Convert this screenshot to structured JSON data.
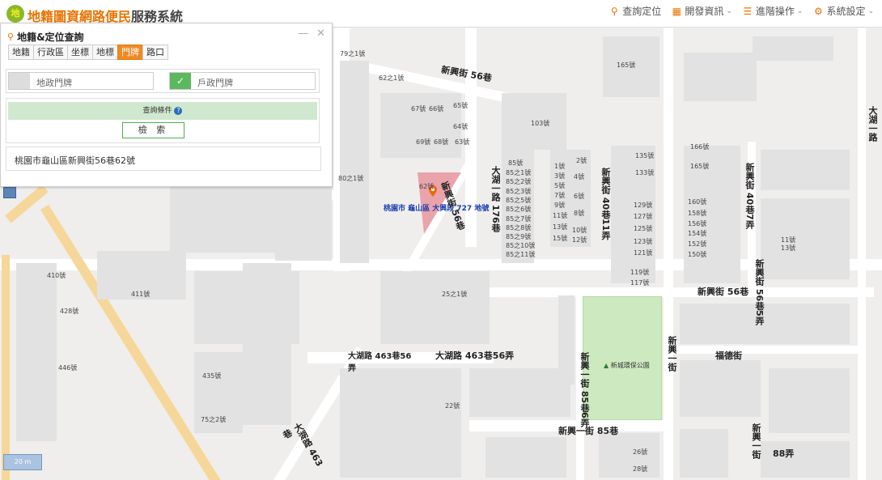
{
  "header": {
    "logo_text": "地",
    "title_orange": "地籍圖資網路便民",
    "title_dark": "服務系統",
    "nav": [
      {
        "label": "查詢定位",
        "icon": "location-pin-icon"
      },
      {
        "label": "開發資訊",
        "icon": "image-icon"
      },
      {
        "label": "進階操作",
        "icon": "list-icon"
      },
      {
        "label": "系統設定",
        "icon": "gear-icon"
      }
    ]
  },
  "panel": {
    "title": "地籍&定位查詢",
    "tabs": [
      "地籍",
      "行政區",
      "坐標",
      "地標",
      "門牌",
      "路口"
    ],
    "active_tab": "門牌",
    "fields": [
      {
        "placeholder": "地政門牌",
        "checked": false
      },
      {
        "placeholder": "戶政門牌",
        "checked": true
      }
    ],
    "condition_label": "查詢條件",
    "search_label": "檢 索",
    "result_text": "桃園市龜山區新興街56巷62號"
  },
  "map": {
    "address_label": "桃園市 龜山區 大興段 727 地號",
    "scale_label": "20 m",
    "park_label": "新城環保公園",
    "road_labels": {
      "xinxing56": "新興街 56巷",
      "xinxing56b": "新興街 56巷",
      "daxing463_56": "大湖路 463巷56弄",
      "daxing463_56b": "大湖路 463巷56弄",
      "xinxingyi85": "新興一街 85巷",
      "fude": "福德街",
      "bottom88": "88弄"
    },
    "vertical_labels": {
      "dahu176": "大湖一路 176巷",
      "xinxing56_v": "新興街 56巷",
      "xinxing40_11": "新興街 40巷11弄",
      "xinxing40_7": "新興街 40巷7弄",
      "xinxing56_5": "新興街 56巷5弄",
      "xinxingyi": "新興一街",
      "xinxing85_6": "新興一街 85巷6弄",
      "daxing463": "大湖路 463巷",
      "dahu_right": "大湖一路",
      "xinxing_bottom": "新興一街"
    },
    "house_numbers": [
      "79之1號",
      "62之1號",
      "67號",
      "66號",
      "65號",
      "64號",
      "69號",
      "68號",
      "63號",
      "103號",
      "85號",
      "85之1號",
      "85之2號",
      "85之3號",
      "85之5號",
      "85之6號",
      "85之7號",
      "85之8號",
      "85之9號",
      "85之10號",
      "85之11號",
      "80之1號",
      "62號",
      "25之1號",
      "410號",
      "411號",
      "428號",
      "446號",
      "435號",
      "75之2號",
      "22號",
      "26號",
      "28號",
      "2號",
      "4號",
      "6號",
      "8號",
      "10號",
      "12號",
      "1號",
      "3號",
      "5號",
      "7號",
      "9號",
      "11號",
      "13號",
      "15號",
      "165號",
      "135號",
      "133號",
      "129號",
      "127號",
      "125號",
      "123號",
      "121號",
      "119號",
      "117號",
      "166號",
      "165號",
      "160號",
      "158號",
      "156號",
      "154號",
      "152號",
      "150號",
      "13號",
      "11號"
    ]
  }
}
